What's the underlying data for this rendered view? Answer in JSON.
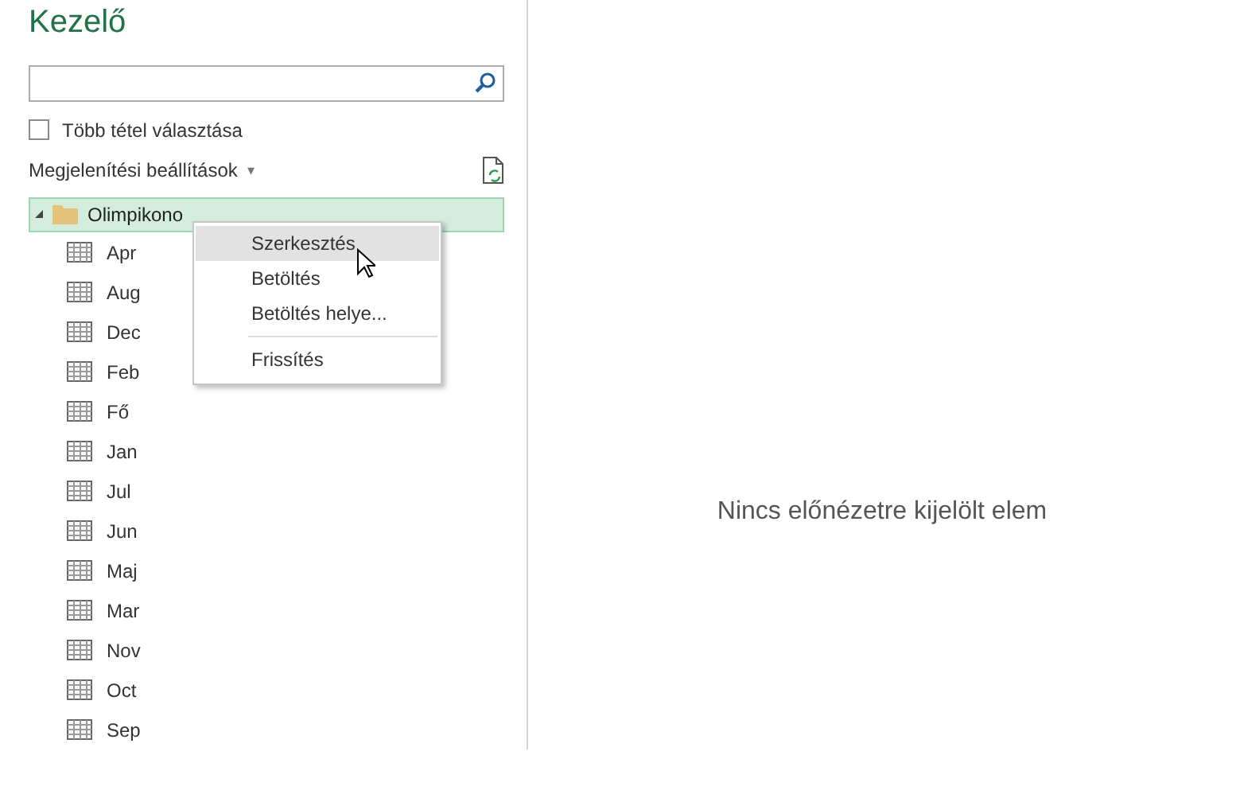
{
  "title": "Kezelő",
  "multi_select": {
    "label": "Több tétel választása",
    "checked": false
  },
  "display_options": {
    "label": "Megjelenítési beállítások",
    "caret": "▾"
  },
  "tree": {
    "label": "Olimpikono",
    "expanded": true,
    "selected": true,
    "children": [
      {
        "label": "Apr"
      },
      {
        "label": "Aug"
      },
      {
        "label": "Dec"
      },
      {
        "label": "Feb"
      },
      {
        "label": "Fő"
      },
      {
        "label": "Jan"
      },
      {
        "label": "Jul"
      },
      {
        "label": "Jun"
      },
      {
        "label": "Maj"
      },
      {
        "label": "Mar"
      },
      {
        "label": "Nov"
      },
      {
        "label": "Oct"
      },
      {
        "label": "Sep"
      }
    ]
  },
  "context_menu": [
    {
      "kind": "item",
      "label": "Szerkesztés",
      "selected": true
    },
    {
      "kind": "item",
      "label": "Betöltés",
      "selected": false
    },
    {
      "kind": "item",
      "label": "Betöltés helye...",
      "selected": false
    },
    {
      "kind": "separator"
    },
    {
      "kind": "item",
      "label": "Frissítés",
      "selected": false
    }
  ],
  "preview": {
    "message": "Nincs előnézetre kijelölt elem"
  }
}
